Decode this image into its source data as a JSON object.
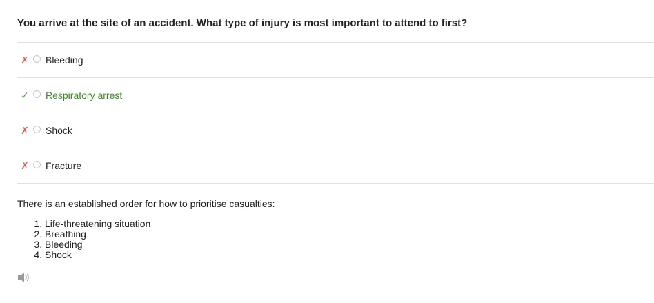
{
  "question": {
    "text": "You arrive at the site of an accident. What type of injury is most important to attend to first?"
  },
  "options": [
    {
      "label": "Bleeding",
      "result_icon": "x-mark-icon",
      "correct": false
    },
    {
      "label": "Respiratory arrest",
      "result_icon": "check-mark-icon",
      "correct": true
    },
    {
      "label": "Shock",
      "result_icon": "x-mark-icon",
      "correct": false
    },
    {
      "label": "Fracture",
      "result_icon": "x-mark-icon",
      "correct": false
    }
  ],
  "marks": {
    "wrong_symbol": "✗",
    "right_symbol": "✓"
  },
  "explanation": {
    "intro": "There is an established order for how to prioritise casualties:",
    "items": [
      "Life-threatening situation",
      "Breathing",
      "Bleeding",
      "Shock"
    ]
  },
  "audio": {
    "icon": "speaker-icon"
  },
  "colors": {
    "correct_text": "#3a8a24",
    "wrong_mark": "#e05a5a",
    "right_mark": "#3f9a2f",
    "divider": "#e2e2e2"
  }
}
